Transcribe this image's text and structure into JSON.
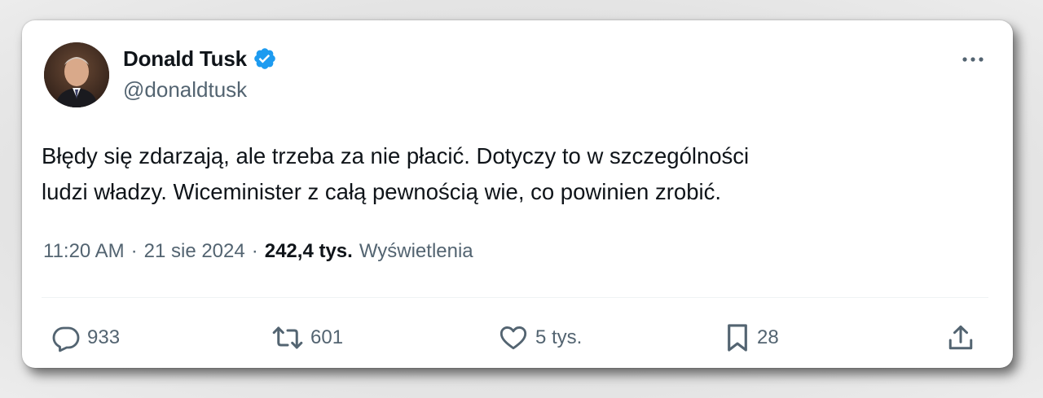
{
  "author": {
    "name": "Donald Tusk",
    "handle": "@donaldtusk",
    "verified_color": "#1d9bf0",
    "avatar_icon": "profile-photo"
  },
  "tweet": {
    "text_line1": "Błędy się zdarzają, ale trzeba za nie płacić. Dotyczy to w szczególności",
    "text_line2": "ludzi władzy. Wiceminister z całą pewnością wie, co powinien zrobić."
  },
  "meta": {
    "time": "11:20 AM",
    "date": "21 sie 2024",
    "separator": "·",
    "views_count": "242,4 tys.",
    "views_label": "Wyświetlenia"
  },
  "actions": {
    "replies": "933",
    "retweets": "601",
    "likes": "5 tys.",
    "bookmarks": "28"
  },
  "icons": {
    "reply": "reply-icon",
    "retweet": "retweet-icon",
    "like": "heart-icon",
    "bookmark": "bookmark-icon",
    "share": "share-icon",
    "more": "more-icon"
  },
  "colors": {
    "text_primary": "#0f1419",
    "text_secondary": "#536471",
    "accent": "#1d9bf0"
  }
}
